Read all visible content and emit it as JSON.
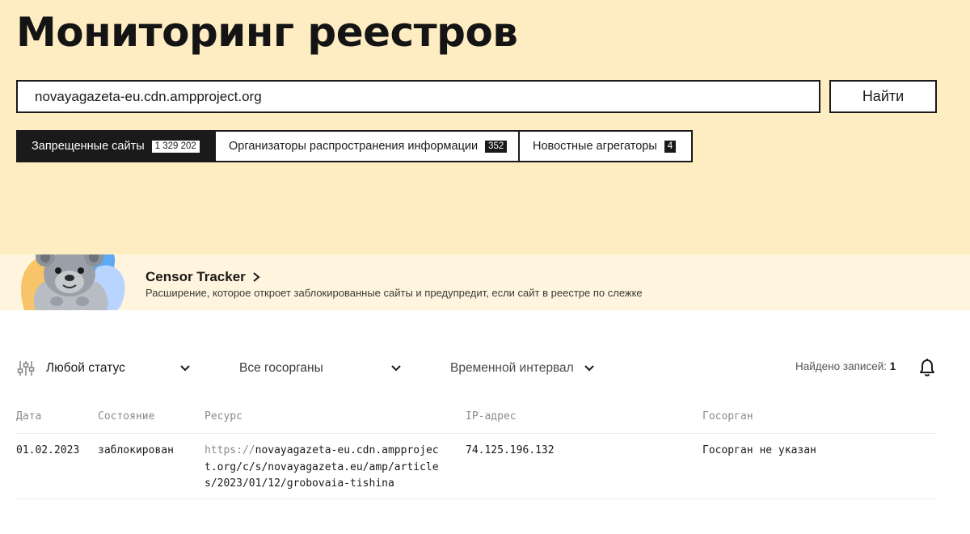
{
  "page": {
    "title": "Мониторинг реестров"
  },
  "search": {
    "value": "novayagazeta-eu.cdn.ampproject.org",
    "button_label": "Найти"
  },
  "tabs": [
    {
      "label": "Запрещенные сайты",
      "count": "1 329 202",
      "active": true
    },
    {
      "label": "Организаторы распространения информации",
      "count": "352",
      "active": false
    },
    {
      "label": "Новостные агрегаторы",
      "count": "4",
      "active": false
    }
  ],
  "promo": {
    "title": "Censor Tracker",
    "description": "Расширение, которое откроет заблокированные сайты и предупредит, если сайт в реестре по слежке",
    "art": "quokka-illustration"
  },
  "filters": {
    "icon": "sliders-icon",
    "status": "Любой статус",
    "agency": "Все госорганы",
    "interval": "Временной интервал",
    "found_label": "Найдено записей:",
    "found_count": "1",
    "bell_icon": "bell-icon"
  },
  "table": {
    "headers": [
      "Дата",
      "Состояние",
      "Ресурс",
      "IP-адрес",
      "Госорган"
    ],
    "rows": [
      {
        "date": "01.02.2023",
        "state": "заблокирован",
        "resource_scheme": "https://",
        "resource_rest": "novayagazeta-eu.cdn.ampproject.org/c/s/novayagazeta.eu/amp/articles/2023/01/12/grobovaia-tishina",
        "ip": "74.125.196.132",
        "agency": "Госорган не указан"
      }
    ]
  },
  "colors": {
    "hero_bg": "#feedc3",
    "promo_bg": "#fff4dd",
    "ink": "#1a1a1a",
    "muted": "#8a8a8a"
  }
}
